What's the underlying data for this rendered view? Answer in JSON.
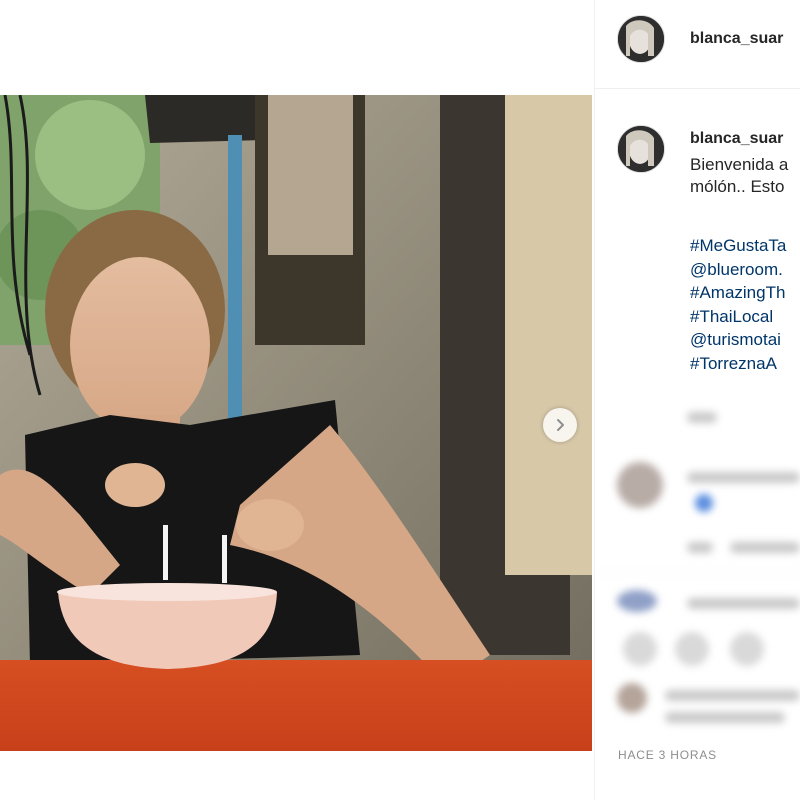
{
  "post": {
    "username": "blanca_suar",
    "caption_line1": "Bienvenida a",
    "caption_line2": "mólón.. Esto",
    "hashtags": [
      "#MeGustaTa",
      "@blueroom.",
      "#AmazingTh",
      "#ThaiLocal",
      "@turismotai",
      "#TorreznaA"
    ],
    "timestamp": "HACE 3 HORAS"
  },
  "icons": {
    "carousel_next": "chevron-right-icon"
  },
  "colors": {
    "link": "#003569",
    "muted": "#8e8e8e",
    "table": "#d9471c"
  }
}
